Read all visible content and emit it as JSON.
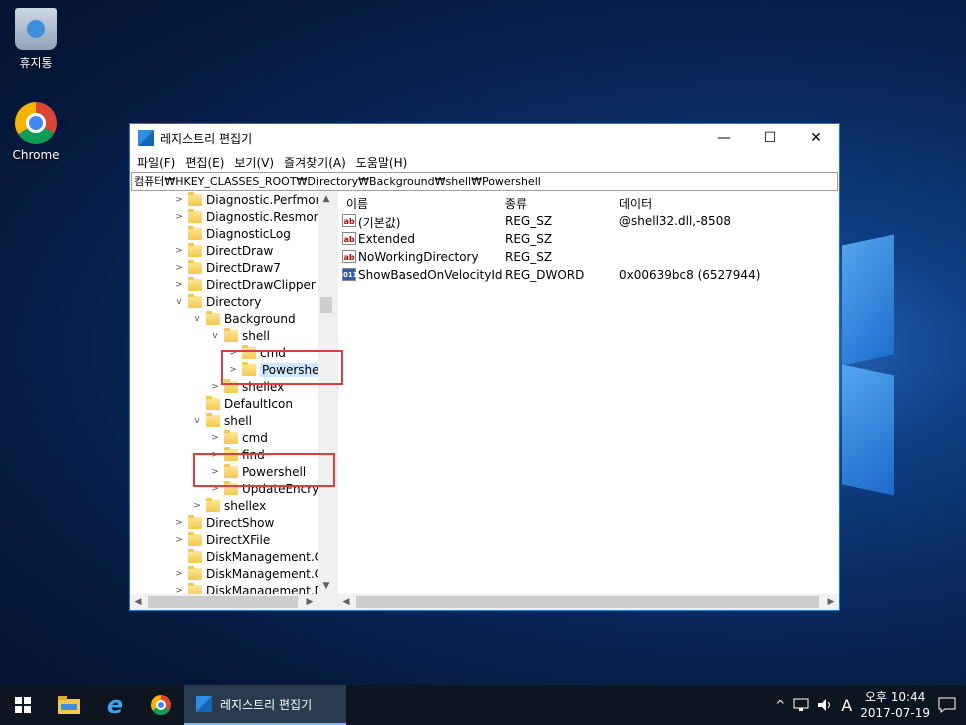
{
  "desktop": {
    "icons": [
      {
        "label": "휴지통"
      },
      {
        "label": "Chrome"
      }
    ]
  },
  "window": {
    "title": "레지스트리 편집기",
    "controls": {
      "minimize": "—",
      "maximize": "☐",
      "close": "✕"
    },
    "menu": [
      "파일(F)",
      "편집(E)",
      "보기(V)",
      "즐겨찾기(A)",
      "도움말(H)"
    ],
    "address": "컴퓨터₩HKEY_CLASSES_ROOT₩Directory₩Background₩shell₩Powershell"
  },
  "tree": [
    {
      "label": "Diagnostic.Perfmon.D",
      "expander": ">"
    },
    {
      "label": "Diagnostic.Resmon.C",
      "expander": ">"
    },
    {
      "label": "DiagnosticLog",
      "expander": ""
    },
    {
      "label": "DirectDraw",
      "expander": ">"
    },
    {
      "label": "DirectDraw7",
      "expander": ">"
    },
    {
      "label": "DirectDrawClipper",
      "expander": ">"
    },
    {
      "label": "Directory",
      "expander": "v"
    },
    {
      "label": "Background",
      "expander": "v"
    },
    {
      "label": "shell",
      "expander": "v"
    },
    {
      "label": "cmd",
      "expander": ">"
    },
    {
      "label": "Powershell",
      "expander": ">",
      "selected": true
    },
    {
      "label": "shellex",
      "expander": ">"
    },
    {
      "label": "DefaultIcon",
      "expander": ""
    },
    {
      "label": "shell",
      "expander": "v"
    },
    {
      "label": "cmd",
      "expander": ">"
    },
    {
      "label": "find",
      "expander": ">"
    },
    {
      "label": "Powershell",
      "expander": ">"
    },
    {
      "label": "UpdateEncrypt",
      "expander": ">"
    },
    {
      "label": "shellex",
      "expander": ">"
    },
    {
      "label": "DirectShow",
      "expander": ">"
    },
    {
      "label": "DirectXFile",
      "expander": ">"
    },
    {
      "label": "DiskManagement.Cor",
      "expander": ""
    },
    {
      "label": "DiskManagement.Cor",
      "expander": ">"
    },
    {
      "label": "DiskManagement.Dat",
      "expander": ">"
    }
  ],
  "values": {
    "headers": {
      "name": "이름",
      "type": "종류",
      "data": "데이터"
    },
    "rows": [
      {
        "icon": "ab",
        "name": "(기본값)",
        "type": "REG_SZ",
        "data": "@shell32.dll,-8508"
      },
      {
        "icon": "ab",
        "name": "Extended",
        "type": "REG_SZ",
        "data": ""
      },
      {
        "icon": "ab",
        "name": "NoWorkingDirectory",
        "type": "REG_SZ",
        "data": ""
      },
      {
        "icon": "bin",
        "name": "ShowBasedOnVelocityId",
        "type": "REG_DWORD",
        "data": "0x00639bc8 (6527944)"
      }
    ]
  },
  "taskbar": {
    "active_app": "레지스트리 편집기",
    "tray": {
      "caret": "^",
      "ime": "A",
      "time": "오후 10:44",
      "date": "2017-07-19"
    }
  },
  "colors": {
    "accent": "#1979ca",
    "highlight_box": "#e33b3b",
    "selection": "#cce8ff"
  }
}
